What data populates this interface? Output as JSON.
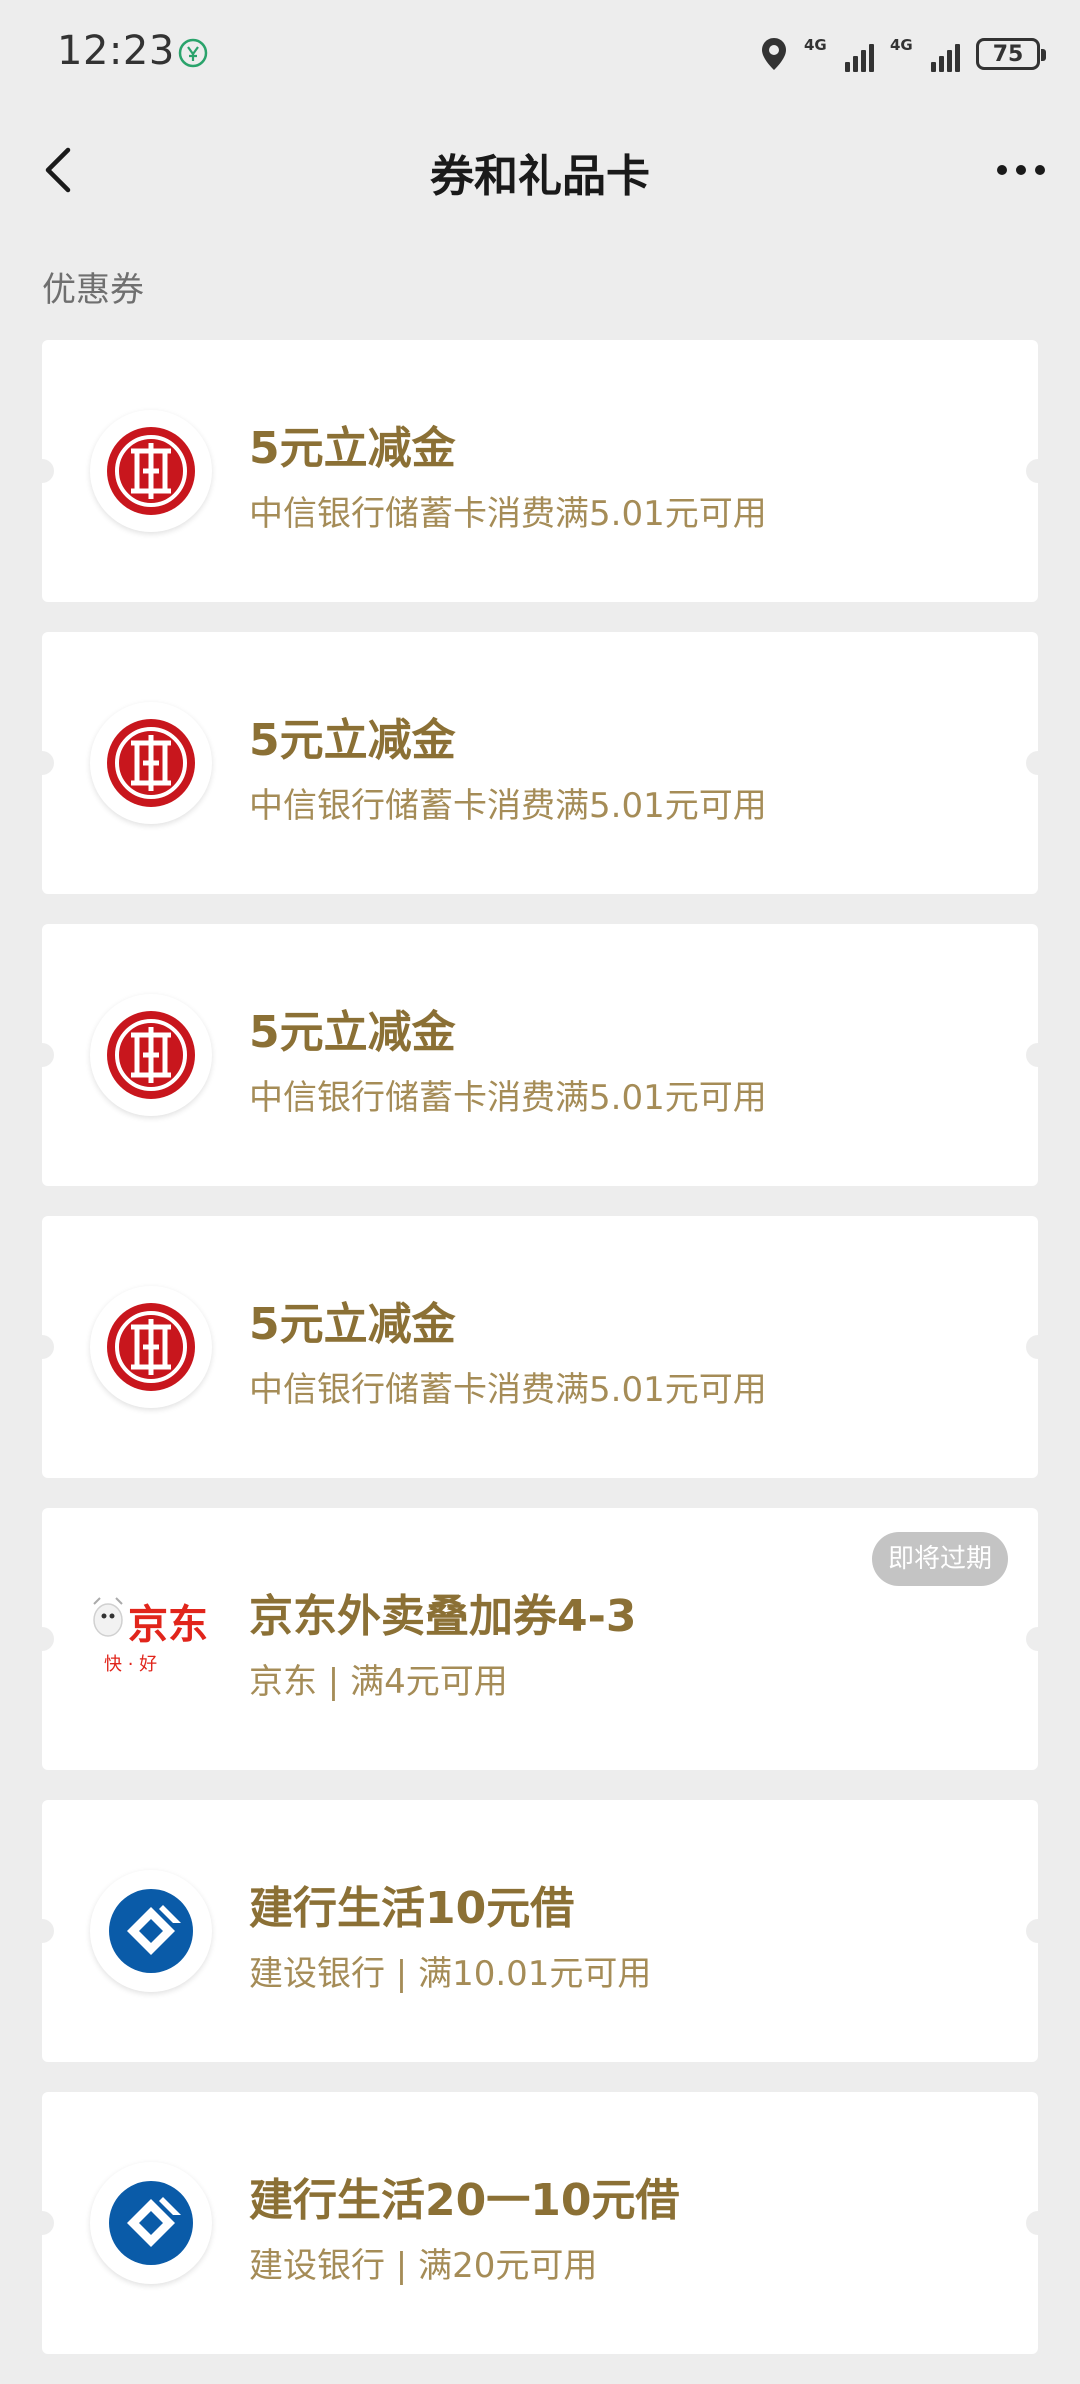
{
  "status_bar": {
    "time": "12:23",
    "network_1": "4G",
    "network_2": "4G",
    "battery": "75",
    "icons": [
      "app-notification-icon",
      "location-icon",
      "signal-icon",
      "signal-icon",
      "battery-icon"
    ]
  },
  "nav": {
    "title": "券和礼品卡",
    "back_icon": "chevron-left-icon",
    "more_icon": "more-dots-icon"
  },
  "section": {
    "label": "优惠券"
  },
  "coupons": [
    {
      "title": "5元立减金",
      "desc": "中信银行储蓄卡消费满5.01元可用",
      "logo": "citic-bank-logo"
    },
    {
      "title": "5元立减金",
      "desc": "中信银行储蓄卡消费满5.01元可用",
      "logo": "citic-bank-logo"
    },
    {
      "title": "5元立减金",
      "desc": "中信银行储蓄卡消费满5.01元可用",
      "logo": "citic-bank-logo"
    },
    {
      "title": "5元立减金",
      "desc": "中信银行储蓄卡消费满5.01元可用",
      "logo": "citic-bank-logo"
    },
    {
      "title": "京东外卖叠加券4-3",
      "desc": "京东 | 满4元可用",
      "logo": "jd-logo",
      "badge": "即将过期",
      "logo_text": "京东",
      "logo_sub": "快 · 好"
    },
    {
      "title": "建行生活10元借",
      "desc": "建设银行 | 满10.01元可用",
      "logo": "ccb-logo"
    },
    {
      "title": "建行生活20一10元借",
      "desc": "建设银行 | 满20元可用",
      "logo": "ccb-logo"
    }
  ],
  "colors": {
    "background": "#ededed",
    "card": "#ffffff",
    "title_gold": "#8b7035",
    "desc_gold": "#a58c57",
    "citic_red": "#c8161d",
    "ccb_blue": "#0a5ba8",
    "jd_red": "#e1251b",
    "badge_gray": "#c4c4c4"
  }
}
